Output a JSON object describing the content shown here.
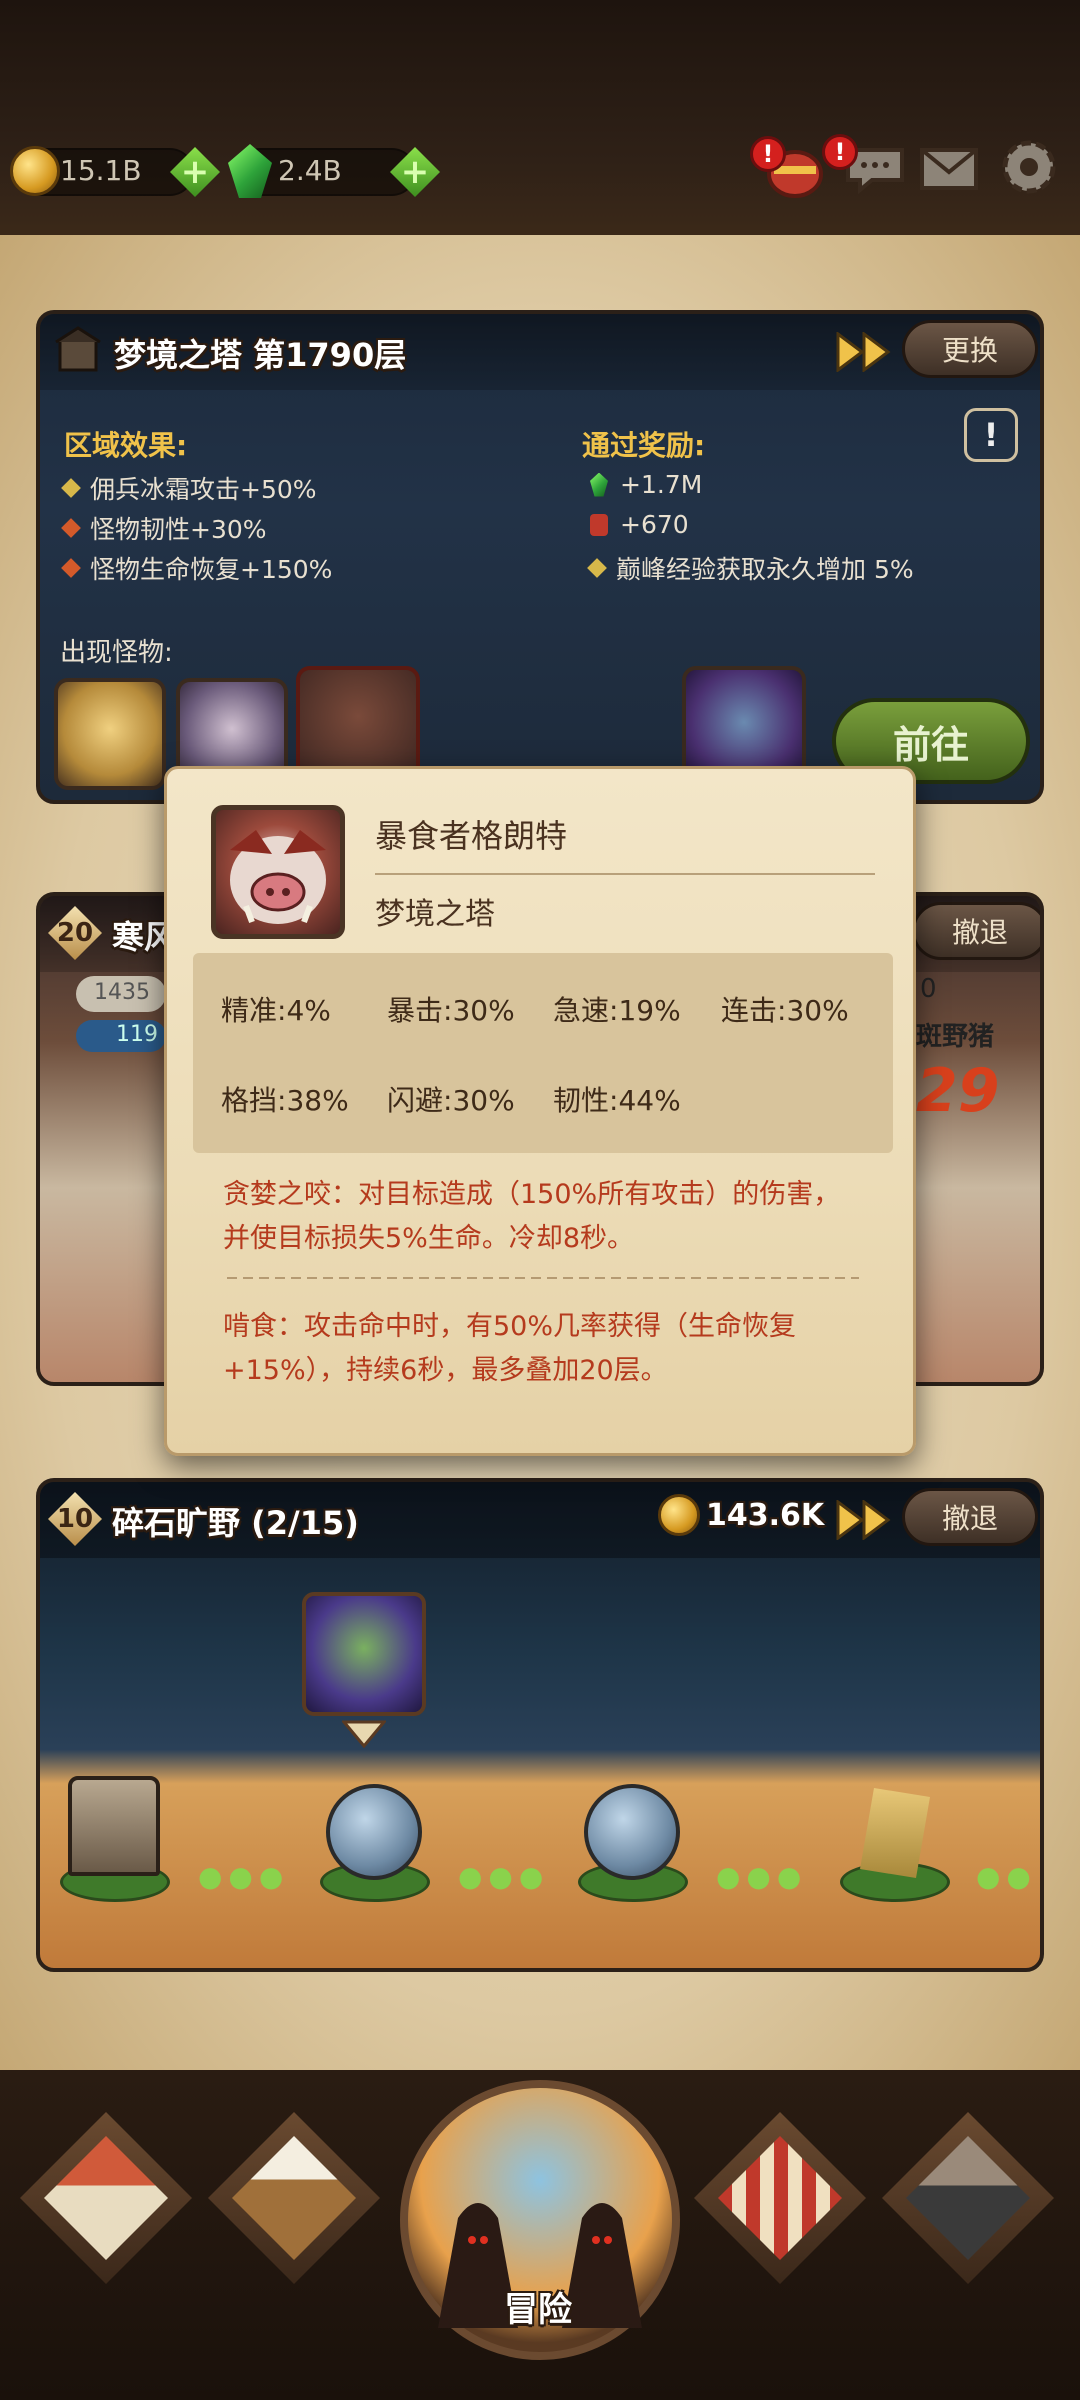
{
  "resources": {
    "gold": "15.1B",
    "gems": "2.4B"
  },
  "top_icons": [
    "chest-icon",
    "chat-icon",
    "mail-icon",
    "settings-icon"
  ],
  "tower": {
    "title": "梦境之塔 第1790层",
    "swap_label": "更换",
    "area_effects_label": "区域效果:",
    "area_effects": [
      "佣兵冰霜攻击+50%",
      "怪物韧性+30%",
      "怪物生命恢复+150%"
    ],
    "rewards_label": "通过奖励:",
    "rewards": [
      "+1.7M",
      "+670",
      "巅峰经验获取永久增加 5%"
    ],
    "monsters_label": "出现怪物:",
    "go_label": "前往",
    "info_label": "!"
  },
  "battle": {
    "level": "20",
    "title": "寒风",
    "value_a": "1435",
    "value_b": "119",
    "retreat_label": "撤退",
    "enemy_name": "斑野猪",
    "enemy_count": "29",
    "progress_end": "0"
  },
  "field": {
    "level": "10",
    "title": "碎石旷野 (2/15)",
    "gold": "143.6K",
    "retreat_label": "撤退"
  },
  "popup": {
    "name": "暴食者格朗特",
    "location": "梦境之塔",
    "stats": [
      {
        "label": "精准:",
        "value": "4%"
      },
      {
        "label": "暴击:",
        "value": "30%"
      },
      {
        "label": "急速:",
        "value": "19%"
      },
      {
        "label": "连击:",
        "value": "30%"
      },
      {
        "label": "格挡:",
        "value": "38%"
      },
      {
        "label": "闪避:",
        "value": "30%"
      },
      {
        "label": "韧性:",
        "value": "44%"
      }
    ],
    "skill1": "贪婪之咬：对目标造成（150%所有攻击）的伤害，并使目标损失5%生命。冷却8秒。",
    "skill2": "啃食：攻击命中时，有50%几率获得（生命恢复+15%），持续6秒，最多叠加20层。"
  },
  "nav": {
    "items": [
      "tavern-icon",
      "beer-icon",
      "adventure",
      "shop-icon",
      "forge-icon"
    ],
    "adventure_label": "冒险"
  },
  "colors": {
    "gold_text": "#f0c24a",
    "skill_text": "#b53a1d",
    "green_button": "#5f8a2c"
  }
}
